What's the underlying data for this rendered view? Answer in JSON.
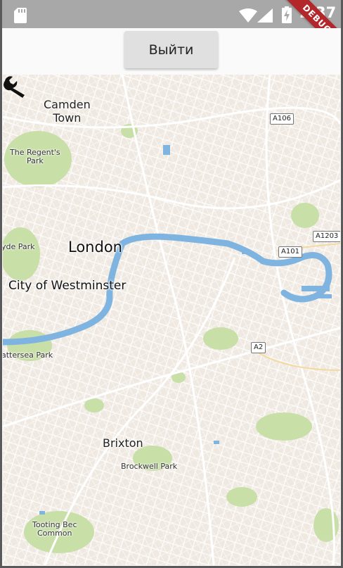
{
  "status_bar": {
    "time": "2:37",
    "debug_banner": "DEBUG"
  },
  "app_bar": {
    "logout_label": "Выйти"
  },
  "map": {
    "labels": {
      "camden": "Camden\nTown",
      "regents_park": "The Regent's\nPark",
      "hyde_park": "yde Park",
      "london": "London",
      "westminster": "City of Westminster",
      "battersea": "attersea Park",
      "brixton": "Brixton",
      "brockwell": "Brockwell Park",
      "tooting": "Tooting Bec\nCommon"
    },
    "road_shields": {
      "a106": "A106",
      "a1203": "A1203",
      "a101": "A101",
      "a2": "A2"
    },
    "marker_icon": "wrench-icon",
    "colors": {
      "water": "#7fb4e0",
      "park": "#c8dfa7",
      "land": "#efe9e1",
      "road": "#ffffff"
    }
  }
}
